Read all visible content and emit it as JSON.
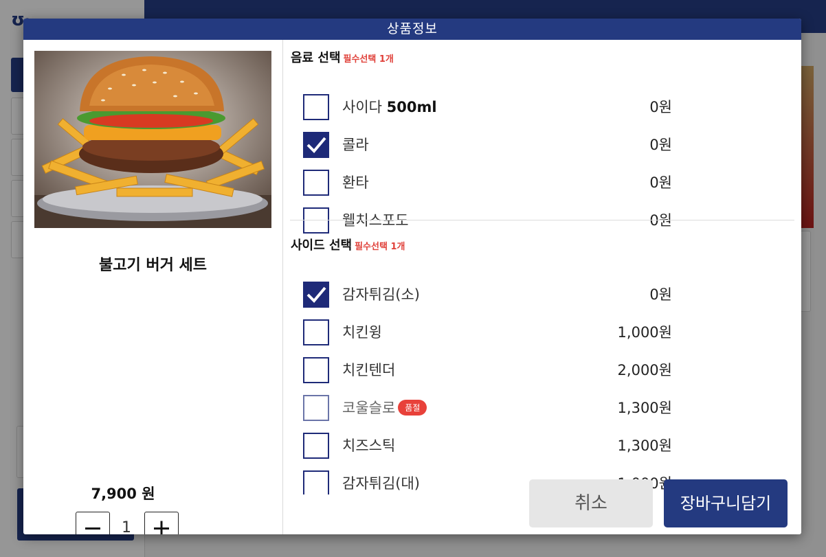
{
  "modal": {
    "title": "상품정보",
    "product": {
      "name": "불고기 버거 세트",
      "price": "7,900 원",
      "quantity": "1",
      "image_icon": "burger-set-photo"
    },
    "sections": [
      {
        "title": "음료 선택",
        "required_label": "필수선택 1개",
        "options": [
          {
            "label": "사이다",
            "label_bold": "500ml",
            "price": "0원",
            "checked": false,
            "sold_out": false
          },
          {
            "label": "콜라",
            "label_bold": "",
            "price": "0원",
            "checked": true,
            "sold_out": false
          },
          {
            "label": "환타",
            "label_bold": "",
            "price": "0원",
            "checked": false,
            "sold_out": false
          },
          {
            "label": "웰치스포도",
            "label_bold": "",
            "price": "0원",
            "checked": false,
            "sold_out": false
          }
        ]
      },
      {
        "title": "사이드 선택",
        "required_label": "필수선택 1개",
        "options": [
          {
            "label": "감자튀김(소)",
            "label_bold": "",
            "price": "0원",
            "checked": true,
            "sold_out": false
          },
          {
            "label": "치킨윙",
            "label_bold": "",
            "price": "1,000원",
            "checked": false,
            "sold_out": false
          },
          {
            "label": "치킨텐더",
            "label_bold": "",
            "price": "2,000원",
            "checked": false,
            "sold_out": false
          },
          {
            "label": "코울슬로",
            "label_bold": "",
            "price": "1,300원",
            "checked": false,
            "sold_out": true,
            "badge": "품절"
          },
          {
            "label": "치즈스틱",
            "label_bold": "",
            "price": "1,300원",
            "checked": false,
            "sold_out": false
          },
          {
            "label": "감자튀김(대)",
            "label_bold": "",
            "price": "1,000원",
            "checked": false,
            "sold_out": false
          }
        ]
      }
    ],
    "buttons": {
      "cancel": "취소",
      "add_to_cart": "장바구니담기"
    }
  },
  "colors": {
    "brand": "#243a80",
    "checkbox": "#1e2a78",
    "required": "#e0413a",
    "badge": "#e8413a"
  }
}
